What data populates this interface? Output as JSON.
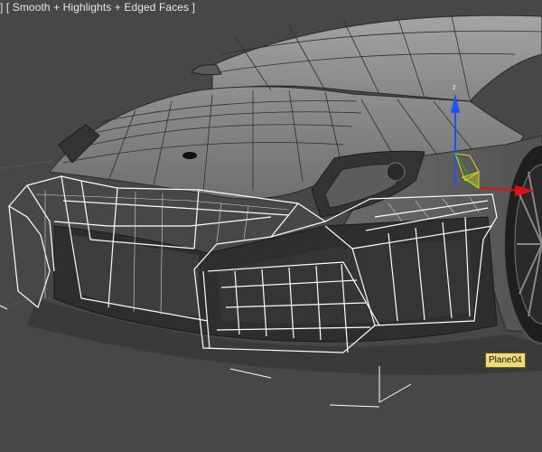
{
  "viewport": {
    "shading_mode_label": "] [ Smooth + Highlights + Edged Faces ]",
    "background_color": "#474747"
  },
  "gizmo": {
    "z_axis_label": "z",
    "x_axis_color": "#e01010",
    "y_axis_color": "#10c010",
    "z_axis_color": "#2050ff"
  },
  "selection": {
    "object_name": "Plane04",
    "wireframe_color": "#ffffff"
  },
  "colors": {
    "tooltip_bg": "#f0da7a",
    "car_body": "#7d7d7d",
    "car_dark": "#2a2a2a"
  }
}
